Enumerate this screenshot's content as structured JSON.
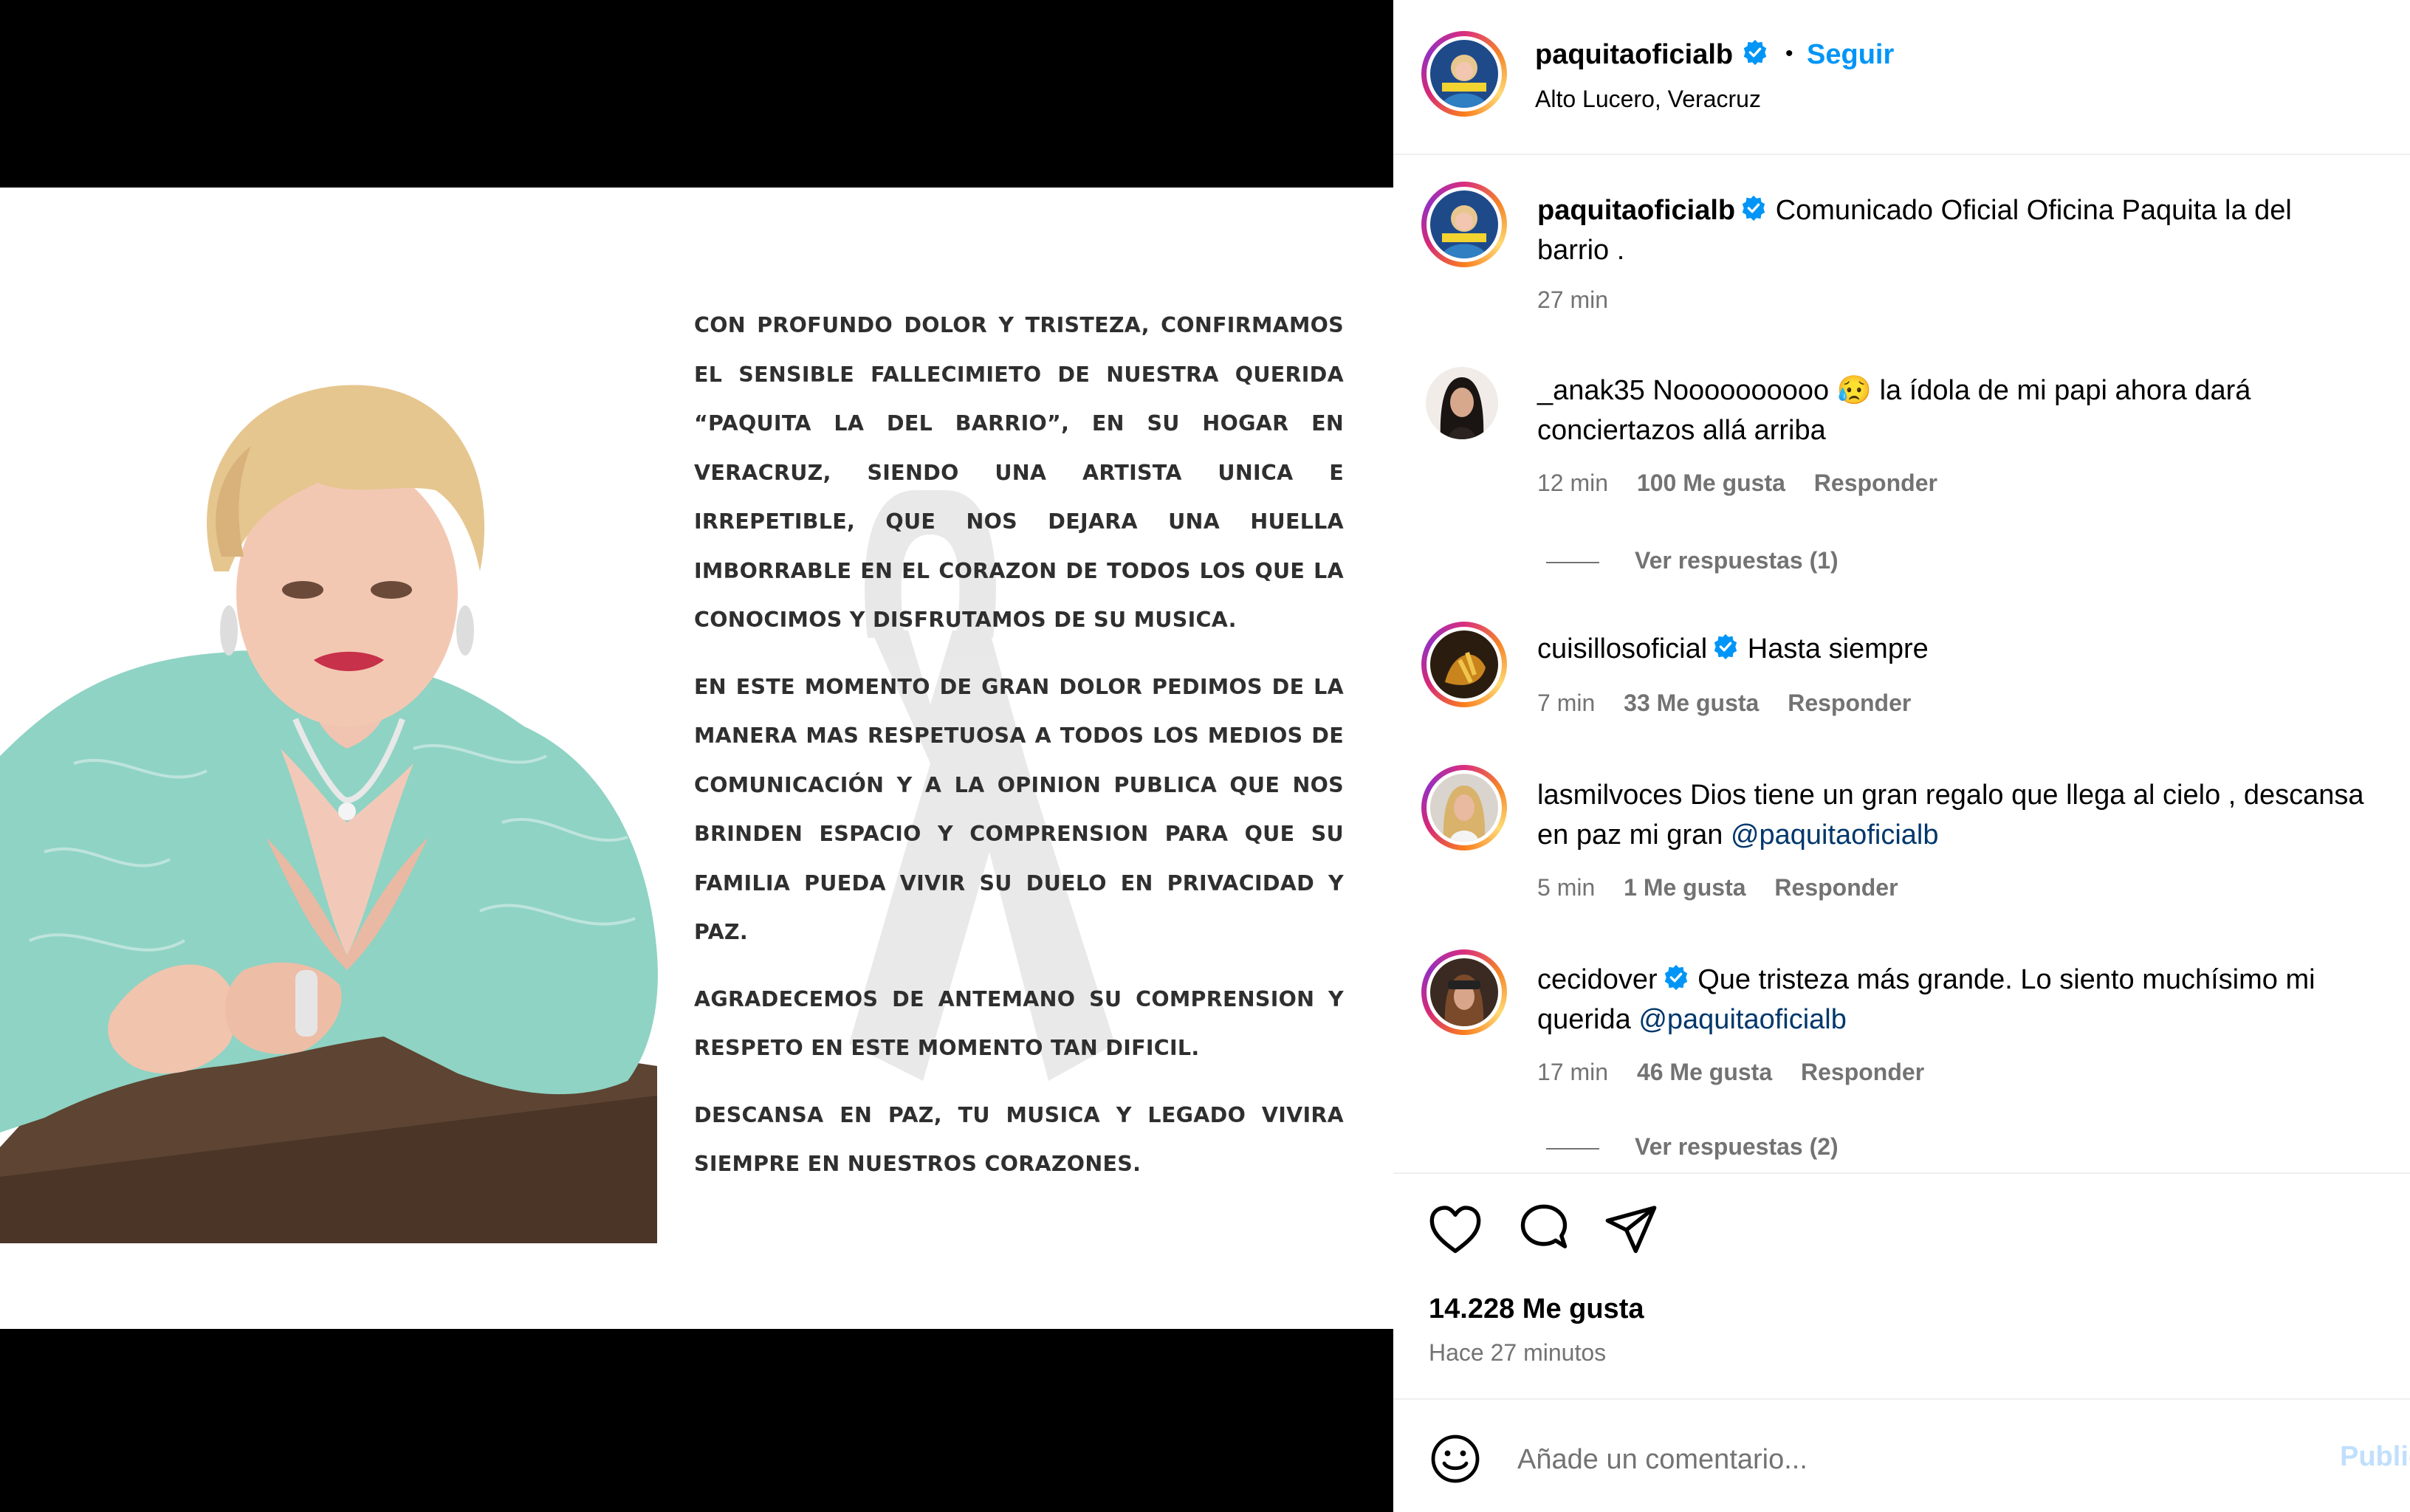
{
  "header": {
    "username": "paquitaoficialb",
    "follow_label": "Seguir",
    "separator": "•",
    "location": "Alto Lucero, Veracruz",
    "avatar_text": "PAQUITA"
  },
  "caption": {
    "username": "paquitaoficialb",
    "text": "Comunicado Oficial Oficina Paquita la del barrio .",
    "time": "27 min"
  },
  "comments": [
    {
      "username": "_anak35",
      "verified": false,
      "text": "Noooooooooo 😥 la ídola de mi papi ahora dará conciertazos allá arriba",
      "time": "12 min",
      "likes": "100 Me gusta",
      "reply_label": "Responder",
      "replies_label": "Ver respuestas (1)"
    },
    {
      "username": "cuisillosoficial",
      "verified": true,
      "text": "Hasta siempre",
      "time": "7 min",
      "likes": "33 Me gusta",
      "reply_label": "Responder"
    },
    {
      "username": "lasmilvoces",
      "verified": false,
      "text": "Dios tiene un gran regalo que llega al cielo , descansa en paz mi gran",
      "mention": "@paquitaoficialb",
      "time": "5 min",
      "likes": "1 Me gusta",
      "reply_label": "Responder"
    },
    {
      "username": "cecidover",
      "verified": true,
      "text": "Que tristeza más grande. Lo siento muchísimo mi querida",
      "mention": "@paquitaoficialb",
      "time": "17 min",
      "likes": "46 Me gusta",
      "reply_label": "Responder",
      "replies_label": "Ver respuestas (2)"
    }
  ],
  "footer": {
    "likes": "14.228 Me gusta",
    "posted": "Hace 27 minutos",
    "comment_placeholder": "Añade un comentario...",
    "publish_label": "Publicar"
  },
  "notice": {
    "paragraphs": [
      "CON PROFUNDO DOLOR Y TRISTEZA, CONFIRMAMOS EL SENSIBLE FALLECIMIETO DE NUESTRA QUERIDA “PAQUITA LA DEL BARRIO”, EN SU HOGAR EN VERACRUZ, SIENDO UNA ARTISTA UNICA E IRREPETIBLE, QUE NOS DEJARA UNA HUELLA IMBORRABLE EN EL CORAZON DE TODOS LOS QUE LA CONOCIMOS Y DISFRUTAMOS DE SU MUSICA.",
      "EN ESTE MOMENTO DE GRAN DOLOR PEDIMOS DE LA MANERA MAS RESPETUOSA A TODOS LOS MEDIOS DE COMUNICACIÓN Y A LA OPINION PUBLICA QUE NOS BRINDEN ESPACIO Y COMPRENSION PARA QUE SU FAMILIA PUEDA VIVIR SU DUELO EN PRIVACIDAD Y PAZ.",
      "AGRADECEMOS DE ANTEMANO SU COMPRENSION Y RESPETO EN ESTE MOMENTO TAN DIFICIL.",
      "DESCANSA EN PAZ, TU MUSICA Y LEGADO VIVIRA SIEMPRE EN NUESTROS CORAZONES."
    ]
  },
  "colors": {
    "accent_blue": "#0095f6",
    "verified_blue": "#0095f6",
    "mention": "#00376b",
    "muted": "#737373",
    "dress": "#8fd3c4"
  }
}
